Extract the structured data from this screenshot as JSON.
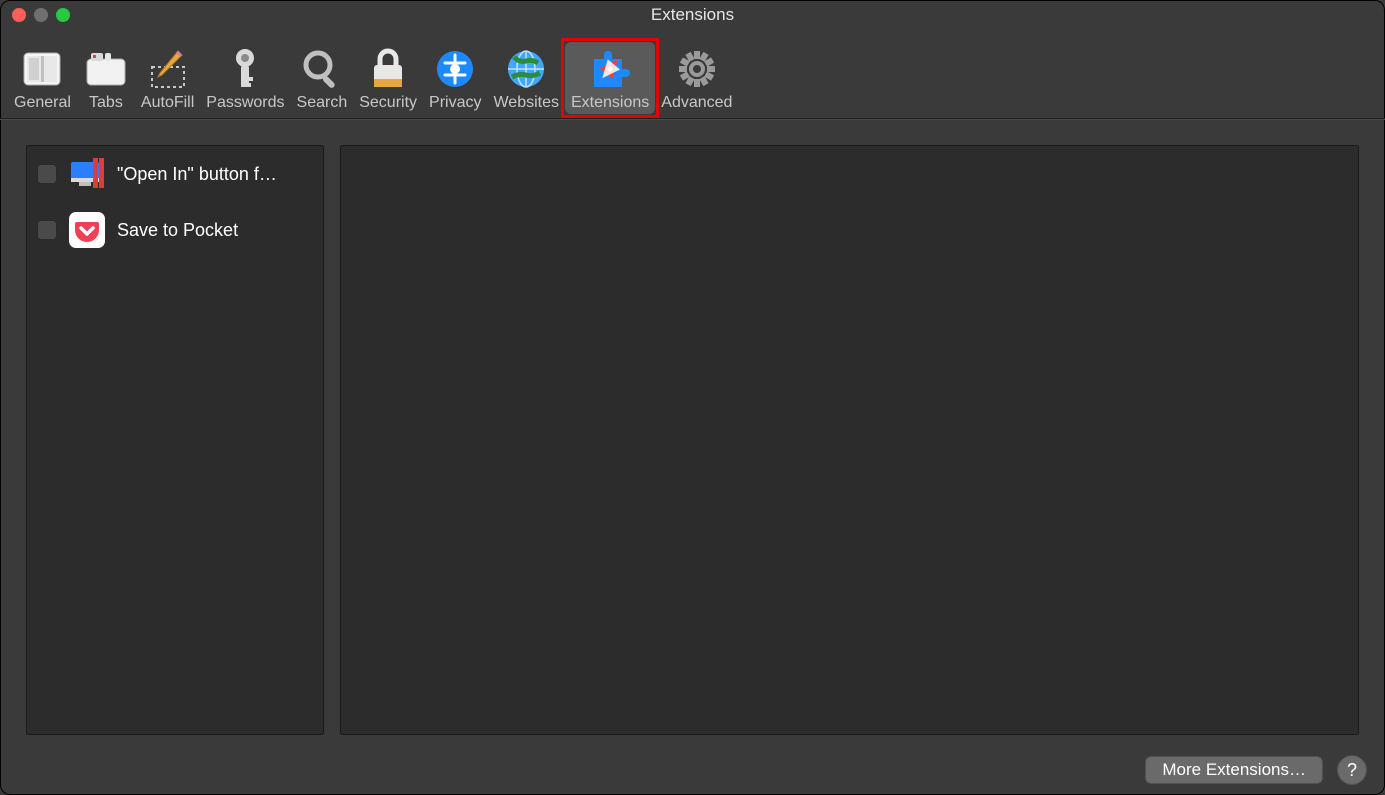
{
  "window_title": "Extensions",
  "toolbar": [
    {
      "id": "general",
      "label": "General",
      "icon": "general-icon"
    },
    {
      "id": "tabs",
      "label": "Tabs",
      "icon": "tabs-icon"
    },
    {
      "id": "autofill",
      "label": "AutoFill",
      "icon": "autofill-icon"
    },
    {
      "id": "passwords",
      "label": "Passwords",
      "icon": "passwords-icon"
    },
    {
      "id": "search",
      "label": "Search",
      "icon": "search-icon"
    },
    {
      "id": "security",
      "label": "Security",
      "icon": "security-icon"
    },
    {
      "id": "privacy",
      "label": "Privacy",
      "icon": "privacy-icon"
    },
    {
      "id": "websites",
      "label": "Websites",
      "icon": "websites-icon"
    },
    {
      "id": "extensions",
      "label": "Extensions",
      "icon": "extensions-icon",
      "selected": true,
      "highlighted": true
    },
    {
      "id": "advanced",
      "label": "Advanced",
      "icon": "advanced-icon"
    }
  ],
  "extensions": [
    {
      "label": "\"Open In\" button f…",
      "icon": "parallels-icon",
      "enabled": false
    },
    {
      "label": "Save to Pocket",
      "icon": "pocket-icon",
      "enabled": false
    }
  ],
  "footer": {
    "more_label": "More Extensions…",
    "help_label": "?"
  }
}
